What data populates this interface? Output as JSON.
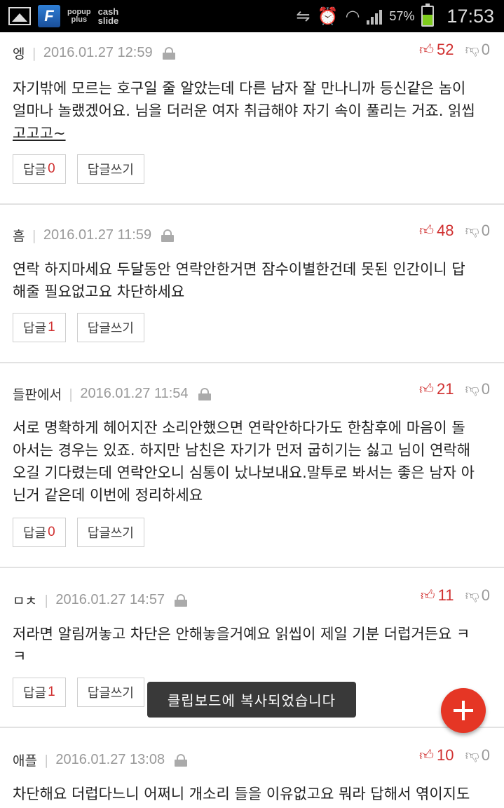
{
  "status_bar": {
    "app_icons": [
      "gallery-icon",
      "f-app-icon"
    ],
    "popup_label": "popup",
    "plus_label": "plus",
    "cash_label": "cash",
    "slide_label": "slide",
    "battery_percent": "57%",
    "battery_level": 57,
    "time": "17:53"
  },
  "comments": [
    {
      "author": "엥",
      "date": "2016.01.27 12:59",
      "likes": "52",
      "dislikes": "0",
      "body_lines": [
        "자기밖에 모르는 호구일 줄 알았는데 다른 남자 잘 만나니까 등신같은 놈이",
        "얼마나 놀랬겠어요. 님을 더러운 여자 취급해야 자기 속이 풀리는 거죠. 읽씹",
        "고고고~"
      ],
      "reply_label": "답글",
      "reply_count": "0",
      "write_label": "답글쓰기"
    },
    {
      "author": "흠",
      "date": "2016.01.27 11:59",
      "likes": "48",
      "dislikes": "0",
      "body_lines": [
        "연락 하지마세요 두달동안 연락안한거면 잠수이별한건데 못된 인간이니 답",
        "해줄 필요없고요 차단하세요"
      ],
      "reply_label": "답글",
      "reply_count": "1",
      "write_label": "답글쓰기"
    },
    {
      "author": "들판에서",
      "date": "2016.01.27 11:54",
      "likes": "21",
      "dislikes": "0",
      "body_lines": [
        "서로 명확하게 헤어지잔 소리안했으면 연락안하다가도 한참후에 마음이 돌",
        "아서는 경우는 있죠. 하지만 남친은 자기가 먼저 굽히기는 싫고 님이 연락해",
        "오길 기다렸는데 연락안오니 심통이 났나보내요.말투로 봐서는 좋은 남자 아",
        "닌거 같은데 이번에 정리하세요"
      ],
      "reply_label": "답글",
      "reply_count": "0",
      "write_label": "답글쓰기"
    },
    {
      "author": "ㅁㅊ",
      "date": "2016.01.27 14:57",
      "likes": "11",
      "dislikes": "0",
      "body_lines": [
        "저라면 알림꺼놓고 차단은 안해놓을거예요 읽씹이 제일 기분 더럽거든요 ㅋ",
        "ㅋ"
      ],
      "reply_label": "답글",
      "reply_count": "1",
      "write_label": "답글쓰기"
    },
    {
      "author": "애플",
      "date": "2016.01.27 13:08",
      "likes": "10",
      "dislikes": "0",
      "body_lines": [
        "차단해요 더럽다느니 어쩌니 개소리 들을 이유없고요 뭐라 답해서 엮이지도"
      ]
    }
  ],
  "toast": {
    "text": "클립보드에 복사되었습니다"
  },
  "fab": {
    "icon": "plus-icon"
  },
  "colors": {
    "like": "#d03030",
    "fab": "#e53625",
    "statusbar": "#000000"
  }
}
